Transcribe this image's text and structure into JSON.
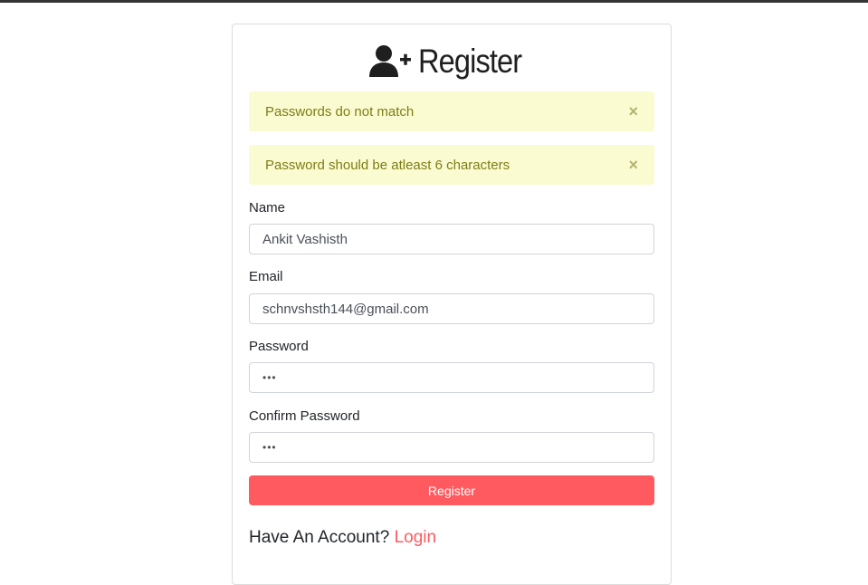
{
  "page": {
    "accent_color": "#ff5a5f",
    "alert_bg": "#fbfbd2",
    "alert_text_color": "#7d7d15"
  },
  "header": {
    "icon": "user-plus-icon",
    "title": "Register"
  },
  "alerts": [
    {
      "message": "Passwords do not match",
      "close_glyph": "×"
    },
    {
      "message": "Password should be atleast 6 characters",
      "close_glyph": "×"
    }
  ],
  "form": {
    "name": {
      "label": "Name",
      "value": "Ankit Vashisth"
    },
    "email": {
      "label": "Email",
      "value": "schnvshsth144@gmail.com"
    },
    "password": {
      "label": "Password",
      "value": "•••"
    },
    "confirm_password": {
      "label": "Confirm Password",
      "value": "•••"
    },
    "submit_label": "Register"
  },
  "footer": {
    "prompt": "Have An Account?",
    "link_label": "Login"
  }
}
